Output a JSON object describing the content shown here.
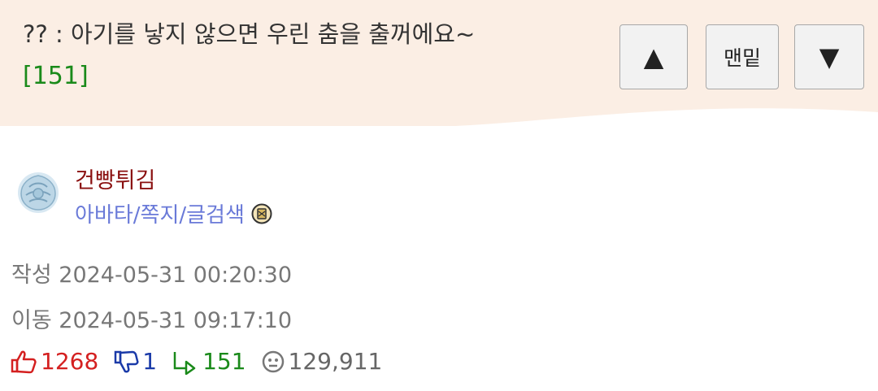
{
  "header": {
    "title": "?? : 아기를 낳지 않으면 우린 춤을 출꺼에요~",
    "comment_count": "[151]",
    "buttons": {
      "up": "▲",
      "bottom": "맨밑",
      "down": "▼"
    }
  },
  "author": {
    "nickname": "건빵튀김",
    "links": "아바타/쪽지/글검색",
    "avatar_icon": "flower-avatar-icon",
    "level_icon": "level-badge-icon"
  },
  "meta": {
    "written": "작성 2024-05-31 00:20:30",
    "moved": "이동 2024-05-31 09:17:10"
  },
  "stats": {
    "likes": "1268",
    "dislikes": "1",
    "replies": "151",
    "views": "129,911"
  },
  "colors": {
    "header_bg": "#fbeee4",
    "like": "#d42020",
    "dislike": "#1a3aa8",
    "reply": "#1a8a1a",
    "nickname": "#8a1010",
    "links": "#6a7ad8"
  }
}
